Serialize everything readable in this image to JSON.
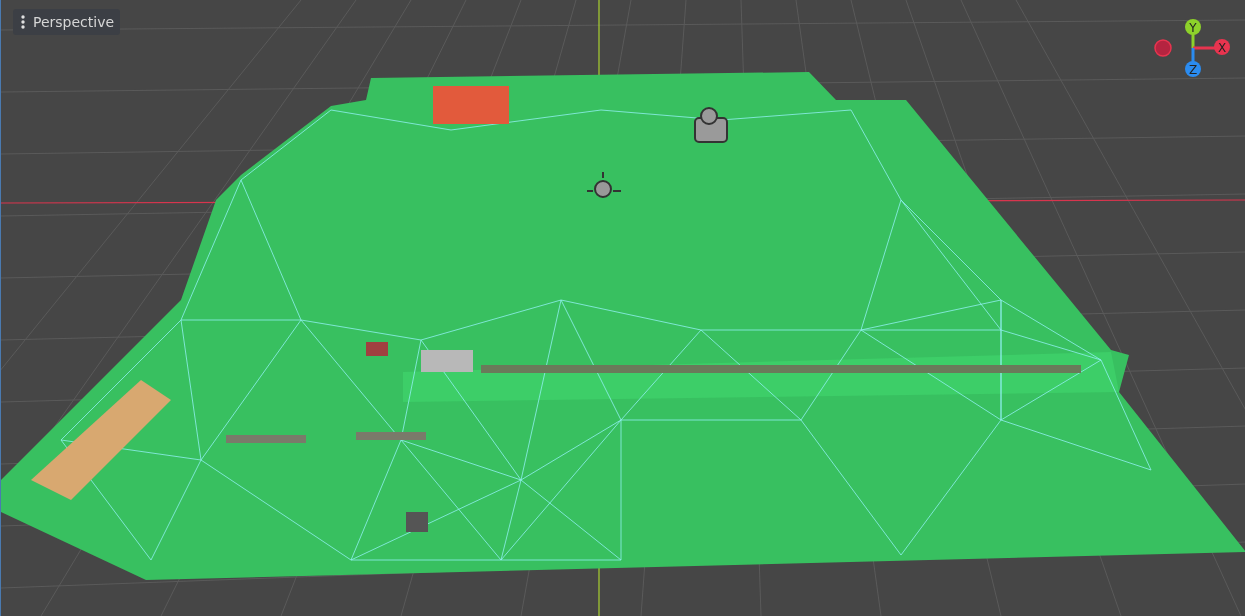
{
  "viewport": {
    "view_menu": {
      "label": "Perspective"
    },
    "gizmo": {
      "axes": [
        {
          "label": "Y",
          "color": "#8dd12a",
          "kind": "positive"
        },
        {
          "label": "X",
          "color": "#e8344f",
          "kind": "positive"
        },
        {
          "label": "Z",
          "color": "#2b8cf0",
          "kind": "positive"
        },
        {
          "color": "#b52440",
          "kind": "negative"
        }
      ]
    }
  }
}
